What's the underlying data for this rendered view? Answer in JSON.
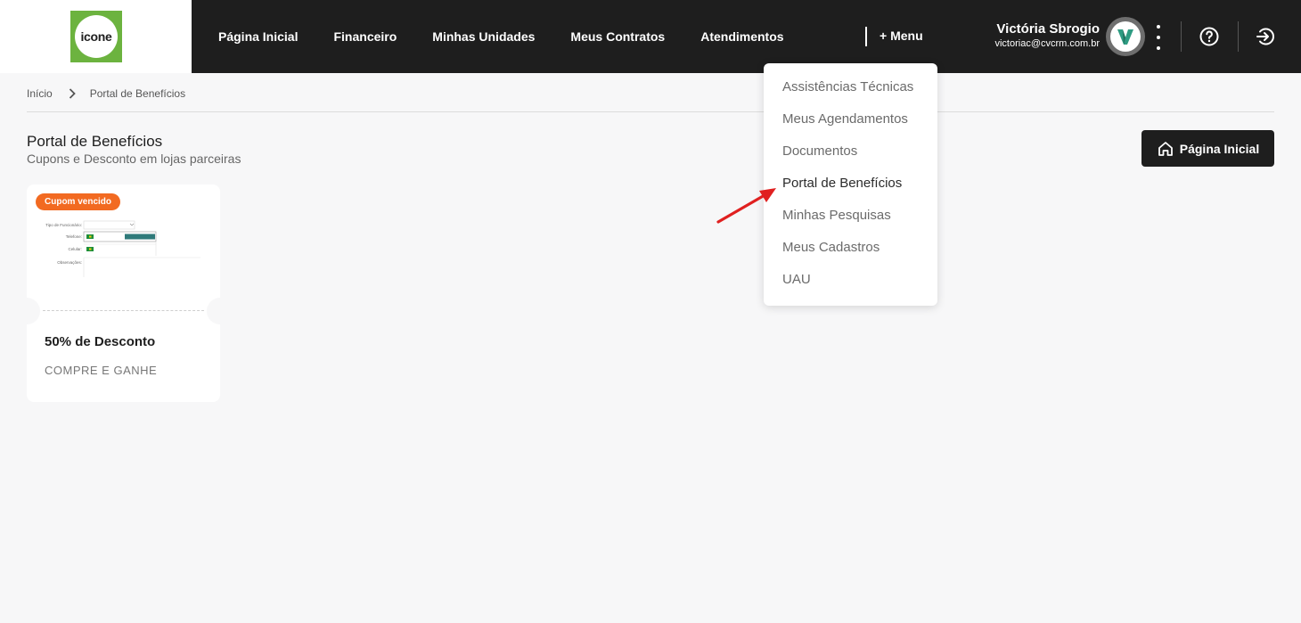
{
  "header": {
    "logo_text": "icone",
    "nav": [
      {
        "label": "Página Inicial"
      },
      {
        "label": "Financeiro"
      },
      {
        "label": "Minhas Unidades"
      },
      {
        "label": "Meus Contratos"
      },
      {
        "label": "Atendimentos"
      }
    ],
    "more_menu_label": "+ Menu",
    "user": {
      "name": "Victória Sbrogio",
      "email": "victoriac@cvcrm.com.br",
      "avatar_letter": "V"
    },
    "icons": [
      "kebab-menu-icon",
      "help-icon",
      "logout-icon"
    ]
  },
  "breadcrumb": {
    "home": "Início",
    "current": "Portal de Benefícios"
  },
  "page": {
    "title": "Portal de Benefícios",
    "subtitle": "Cupons e Desconto em lojas parceiras",
    "home_button": "Página Inicial"
  },
  "coupon": {
    "badge": "Cupom vencido",
    "title": "50% de Desconto",
    "description": "COMPRE E GANHE",
    "thumbnail_form": {
      "field_1_label": "Tipo de Funcionário:",
      "field_2_label": "Telefone:",
      "field_3_label": "Celular:",
      "field_4_label": "Observações:"
    }
  },
  "dropdown": {
    "items": [
      {
        "label": "Assistências Técnicas"
      },
      {
        "label": "Meus Agendamentos"
      },
      {
        "label": "Documentos"
      },
      {
        "label": "Portal de Benefícios"
      },
      {
        "label": "Minhas Pesquisas"
      },
      {
        "label": "Meus Cadastros"
      },
      {
        "label": "UAU"
      }
    ]
  },
  "colors": {
    "header_bg": "#1e1e1e",
    "logo_green": "#6cb33f",
    "badge_orange": "#f26a21",
    "arrow_red": "#e02020",
    "page_bg": "#f7f7f8"
  }
}
